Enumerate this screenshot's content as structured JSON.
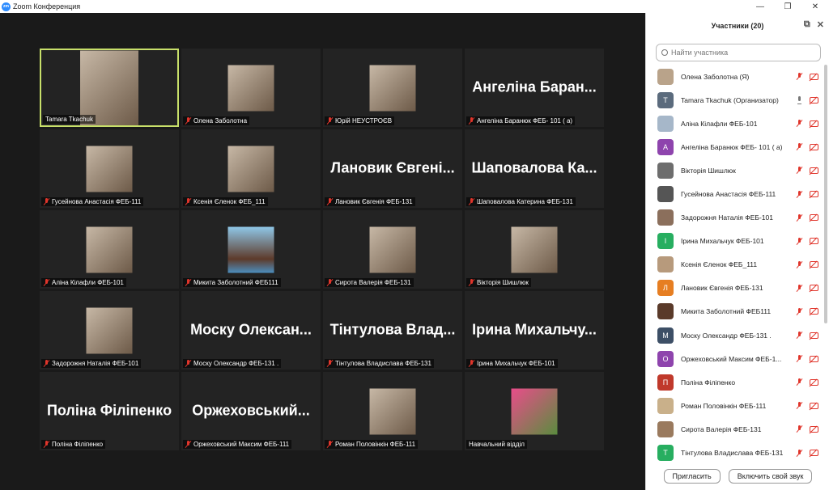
{
  "window": {
    "title": "Zoom Конференция"
  },
  "panel": {
    "title": "Участники (20)",
    "search_placeholder": "Найти участника",
    "invite_label": "Пригласить",
    "unmute_label": "Включить свой звук"
  },
  "tiles": [
    {
      "label": "Tamara Tkachuk",
      "big": "",
      "mic_off": false,
      "video": true,
      "active": true
    },
    {
      "label": "Олена Заболотна",
      "big": "",
      "mic_off": true,
      "video": true
    },
    {
      "label": "Юрій НЕУСТРОЄВ",
      "big": "",
      "mic_off": true,
      "video": true
    },
    {
      "label": "Ангеліна Баранюк ФЕБ- 101 ( а)",
      "big": "Ангеліна Баран...",
      "mic_off": true,
      "video": false
    },
    {
      "label": "Гусейнова Анастасія ФЕБ-111",
      "big": "",
      "mic_off": true,
      "video": true
    },
    {
      "label": "Ксенія Єленок ФЕБ_111",
      "big": "",
      "mic_off": true,
      "video": true
    },
    {
      "label": "Лановик Євгенія ФЕБ-131",
      "big": "Лановик Євгені...",
      "mic_off": true,
      "video": false
    },
    {
      "label": "Шаповалова Катерина ФЕБ-131",
      "big": "Шаповалова Ка...",
      "mic_off": true,
      "video": false
    },
    {
      "label": "Аліна Кілафли ФЕБ-101",
      "big": "",
      "mic_off": true,
      "video": true
    },
    {
      "label": "Микита Заболотний ФЕБ111",
      "big": "",
      "mic_off": true,
      "video": true
    },
    {
      "label": "Сирота Валерія ФЕБ-131",
      "big": "",
      "mic_off": true,
      "video": true
    },
    {
      "label": "Вікторія Шишлюк",
      "big": "",
      "mic_off": true,
      "video": true
    },
    {
      "label": "Задорожня Наталія ФЕБ-101",
      "big": "",
      "mic_off": true,
      "video": true
    },
    {
      "label": "Моску Олександр ФЕБ-131 .",
      "big": "Моску Олексан...",
      "mic_off": true,
      "video": false
    },
    {
      "label": "Тінтулова Владислава ФЕБ-131",
      "big": "Тінтулова Влад...",
      "mic_off": true,
      "video": false
    },
    {
      "label": "Ірина Михальчук ФЕБ-101",
      "big": "Ірина Михальчу...",
      "mic_off": true,
      "video": false
    },
    {
      "label": "Поліна Філіпенко",
      "big": "Поліна Філіпенко",
      "mic_off": true,
      "video": false
    },
    {
      "label": "Оржеховський Максим ФЕБ-111",
      "big": "Оржеховський...",
      "mic_off": true,
      "video": false
    },
    {
      "label": "Роман Половінкін ФЕБ-111",
      "big": "",
      "mic_off": true,
      "video": true
    },
    {
      "label": "Навчальний відділ",
      "big": "",
      "mic_off": false,
      "video": true
    }
  ],
  "participants": [
    {
      "name": "Олена Заболотна (Я)",
      "initial": "",
      "color": "#b9a38a",
      "photo": true,
      "muted": true
    },
    {
      "name": "Tamara Tkachuk (Организатор)",
      "initial": "T",
      "color": "#5b6b7d",
      "photo": false,
      "muted": false
    },
    {
      "name": "Аліна Кілафли ФЕБ-101",
      "initial": "",
      "color": "#a6b7c9",
      "photo": true,
      "muted": true
    },
    {
      "name": "Ангеліна Баранюк ФЕБ- 101 ( а)",
      "initial": "А",
      "color": "#8e44ad",
      "photo": false,
      "muted": true
    },
    {
      "name": "Вікторія Шишлюк",
      "initial": "",
      "color": "#6d6d6d",
      "photo": true,
      "muted": true
    },
    {
      "name": "Гусейнова Анастасія ФЕБ-111",
      "initial": "",
      "color": "#555555",
      "photo": true,
      "muted": true
    },
    {
      "name": "Задорожня Наталія ФЕБ-101",
      "initial": "",
      "color": "#8b6f5c",
      "photo": true,
      "muted": true
    },
    {
      "name": "Ірина Михальчук ФЕБ-101",
      "initial": "І",
      "color": "#27ae60",
      "photo": false,
      "muted": true
    },
    {
      "name": "Ксенія Єленок ФЕБ_111",
      "initial": "",
      "color": "#b79a7c",
      "photo": true,
      "muted": true
    },
    {
      "name": "Лановик Євгенія ФЕБ-131",
      "initial": "Л",
      "color": "#e67e22",
      "photo": false,
      "muted": true
    },
    {
      "name": "Микита Заболотний ФЕБ111",
      "initial": "",
      "color": "#5a3a2a",
      "photo": true,
      "muted": true
    },
    {
      "name": "Моску Олександр ФЕБ-131 .",
      "initial": "М",
      "color": "#3d4f66",
      "photo": false,
      "muted": true
    },
    {
      "name": "Оржеховський Максим ФЕБ-1...",
      "initial": "О",
      "color": "#8e44ad",
      "photo": false,
      "muted": true
    },
    {
      "name": "Поліна Філіпенко",
      "initial": "П",
      "color": "#c0392b",
      "photo": false,
      "muted": true
    },
    {
      "name": "Роман Половінкін ФЕБ-111",
      "initial": "",
      "color": "#c9b08a",
      "photo": true,
      "muted": true
    },
    {
      "name": "Сирота Валерія ФЕБ-131",
      "initial": "",
      "color": "#9a7a5e",
      "photo": true,
      "muted": true
    },
    {
      "name": "Тінтулова Владислава ФЕБ-131",
      "initial": "Т",
      "color": "#27ae60",
      "photo": false,
      "muted": true
    }
  ],
  "colors": {
    "active_border": "#c8e06a",
    "mute_red": "#e0352b"
  }
}
